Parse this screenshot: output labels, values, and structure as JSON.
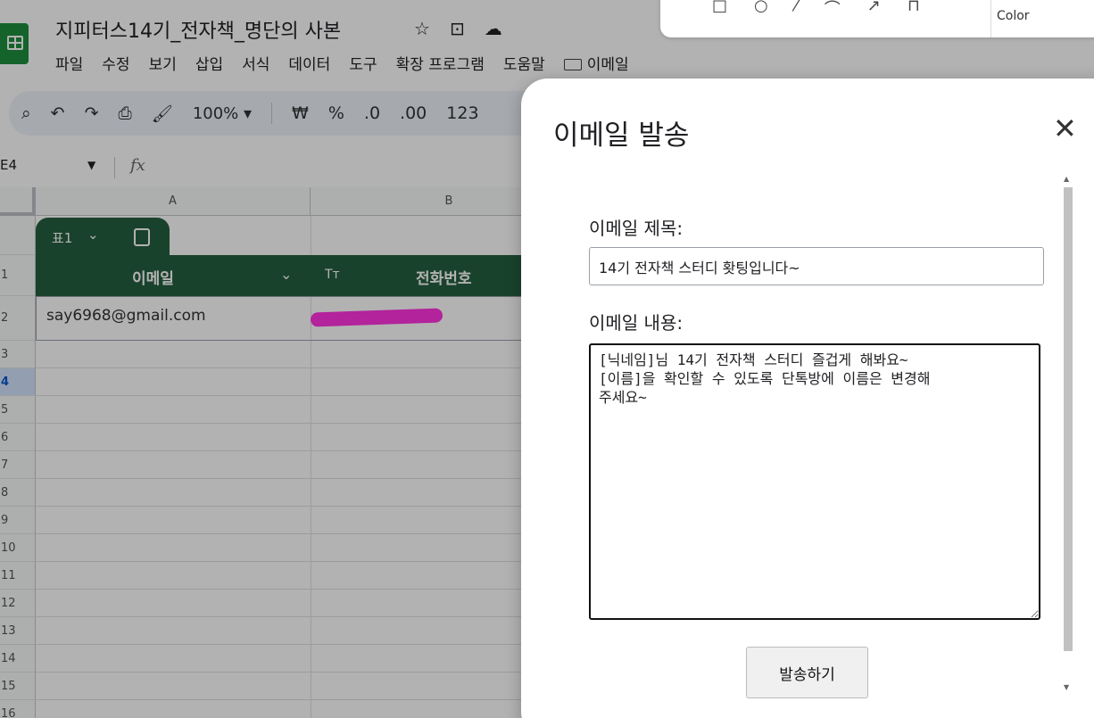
{
  "doc": {
    "title": "지피터스14기_전자책_명단의 사본"
  },
  "menu": [
    "파일",
    "수정",
    "보기",
    "삽입",
    "서식",
    "데이터",
    "도구",
    "확장 프로그램",
    "도움말"
  ],
  "menu_email": "이메일",
  "toolbar": {
    "zoom": "100%",
    "currency": "₩",
    "percent": "%",
    "dec_down": ".0",
    "dec_up": ".00",
    "format": "123"
  },
  "formula": {
    "cell_ref": "E4",
    "fx": "fx"
  },
  "grid": {
    "columns": [
      "A",
      "B"
    ],
    "rows": [
      "1",
      "2",
      "3",
      "4",
      "5",
      "6",
      "7",
      "8",
      "9",
      "10",
      "11",
      "12",
      "13",
      "14",
      "15",
      "16"
    ],
    "selected_row": "4",
    "table_name": "표1",
    "headers": {
      "email": "이메일",
      "phone": "전화번호",
      "type_icon": "Tт"
    },
    "row2_email": "say6968@gmail.com"
  },
  "draw_tools": {
    "color_label": "Color"
  },
  "dialog": {
    "title": "이메일 발송",
    "subject_label": "이메일 제목:",
    "subject_value": "14기 전자책 스터디 홧팅입니다~",
    "body_label": "이메일 내용:",
    "body_value": "[닉네임]님 14기 전자책 스터디 즐겁게 해봐요~\n[이름]을 확인할 수 있도록 단톡방에 이름은 변경해\n주세요~",
    "send_label": "발송하기",
    "close_symbol": "✕"
  },
  "colors": {
    "table_header": "#245f3f",
    "logo": "#1e8e3e",
    "redaction": "#ff33e0"
  }
}
